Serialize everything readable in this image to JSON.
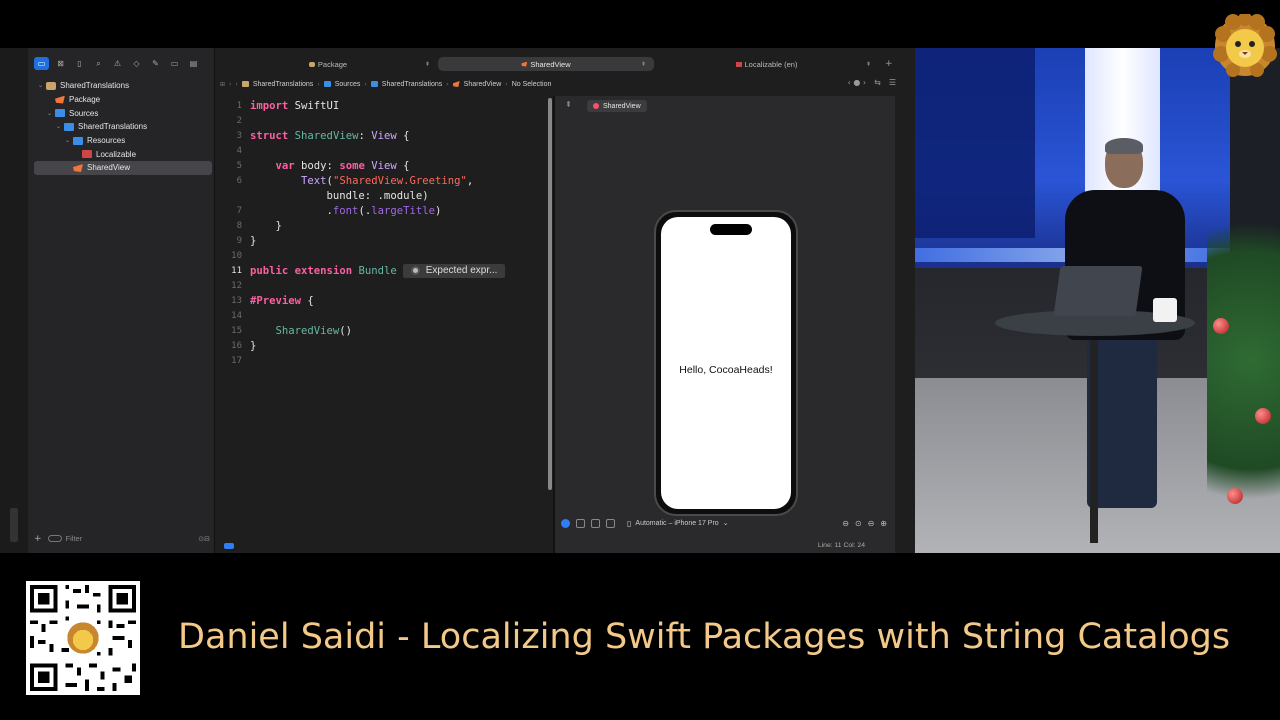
{
  "navigator": {
    "tree": [
      {
        "label": "SharedTranslations",
        "indent": 0,
        "disclosure": "down",
        "icon": "package-icon"
      },
      {
        "label": "Package",
        "indent": 1,
        "disclosure": "",
        "icon": "package-manifest-icon"
      },
      {
        "label": "Sources",
        "indent": 1,
        "disclosure": "down",
        "icon": "folder-icon"
      },
      {
        "label": "SharedTranslations",
        "indent": 2,
        "disclosure": "down",
        "icon": "folder-icon"
      },
      {
        "label": "Resources",
        "indent": 3,
        "disclosure": "down",
        "icon": "folder-icon"
      },
      {
        "label": "Localizable",
        "indent": 4,
        "disclosure": "",
        "icon": "string-catalog-icon"
      },
      {
        "label": "SharedView",
        "indent": 3,
        "disclosure": "",
        "icon": "swift-file-icon",
        "selected": true
      }
    ],
    "filter_placeholder": "Filter"
  },
  "tabs": [
    {
      "label": "Package",
      "active": false
    },
    {
      "label": "SharedView",
      "active": true
    },
    {
      "label": "Localizable (en)",
      "active": false
    }
  ],
  "jumpbar": [
    "SharedTranslations",
    "Sources",
    "SharedTranslations",
    "SharedView",
    "No Selection"
  ],
  "editor": {
    "current_line": 11,
    "error_message": "Expected expr..."
  },
  "canvas": {
    "preview_label": "SharedView",
    "preview_text": "Hello, CocoaHeads!",
    "device": "Automatic – iPhone 17 Pro"
  },
  "status": {
    "cursor": "Line: 11  Col: 24"
  },
  "banner": {
    "title": "Daniel Saidi - Localizing Swift Packages with String Catalogs"
  },
  "colors": {
    "accent": "#1f6fe0",
    "keyword": "#fc5fa3",
    "type": "#d0a8ff",
    "string": "#fc6a5d",
    "banner_text": "#f3c98a"
  }
}
